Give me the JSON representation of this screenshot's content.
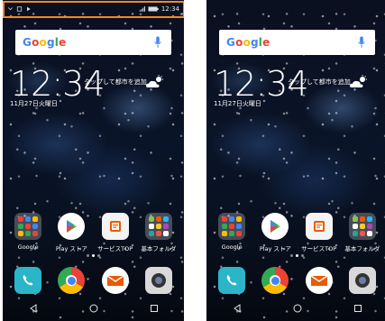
{
  "status_bar": {
    "time": "12:34"
  },
  "search": {
    "logo": [
      "G",
      "o",
      "o",
      "g",
      "l",
      "e"
    ]
  },
  "clock": {
    "time": "12:34",
    "date": "11月27日火曜日",
    "weather_prompt": "タップして都市を追加"
  },
  "apps": [
    {
      "label": "Google",
      "icon": "google-folder-icon"
    },
    {
      "label": "Play ストア",
      "icon": "play-store-icon"
    },
    {
      "label": "サービスTOP",
      "icon": "au-service-top-icon"
    },
    {
      "label": "基本フォルダ",
      "icon": "basic-folder-icon"
    }
  ],
  "dock": [
    {
      "icon": "phone-icon"
    },
    {
      "icon": "chrome-icon"
    },
    {
      "icon": "au-mail-icon"
    },
    {
      "icon": "camera-icon"
    }
  ],
  "page_indicator": {
    "pages": 3,
    "active": 2
  },
  "navbar": [
    "back-icon",
    "home-icon",
    "recents-icon"
  ],
  "colors": {
    "highlight": "#f18a21",
    "google_blue": "#4285f4",
    "google_red": "#ea4335",
    "google_yellow": "#fbbc05",
    "google_green": "#34a853"
  }
}
